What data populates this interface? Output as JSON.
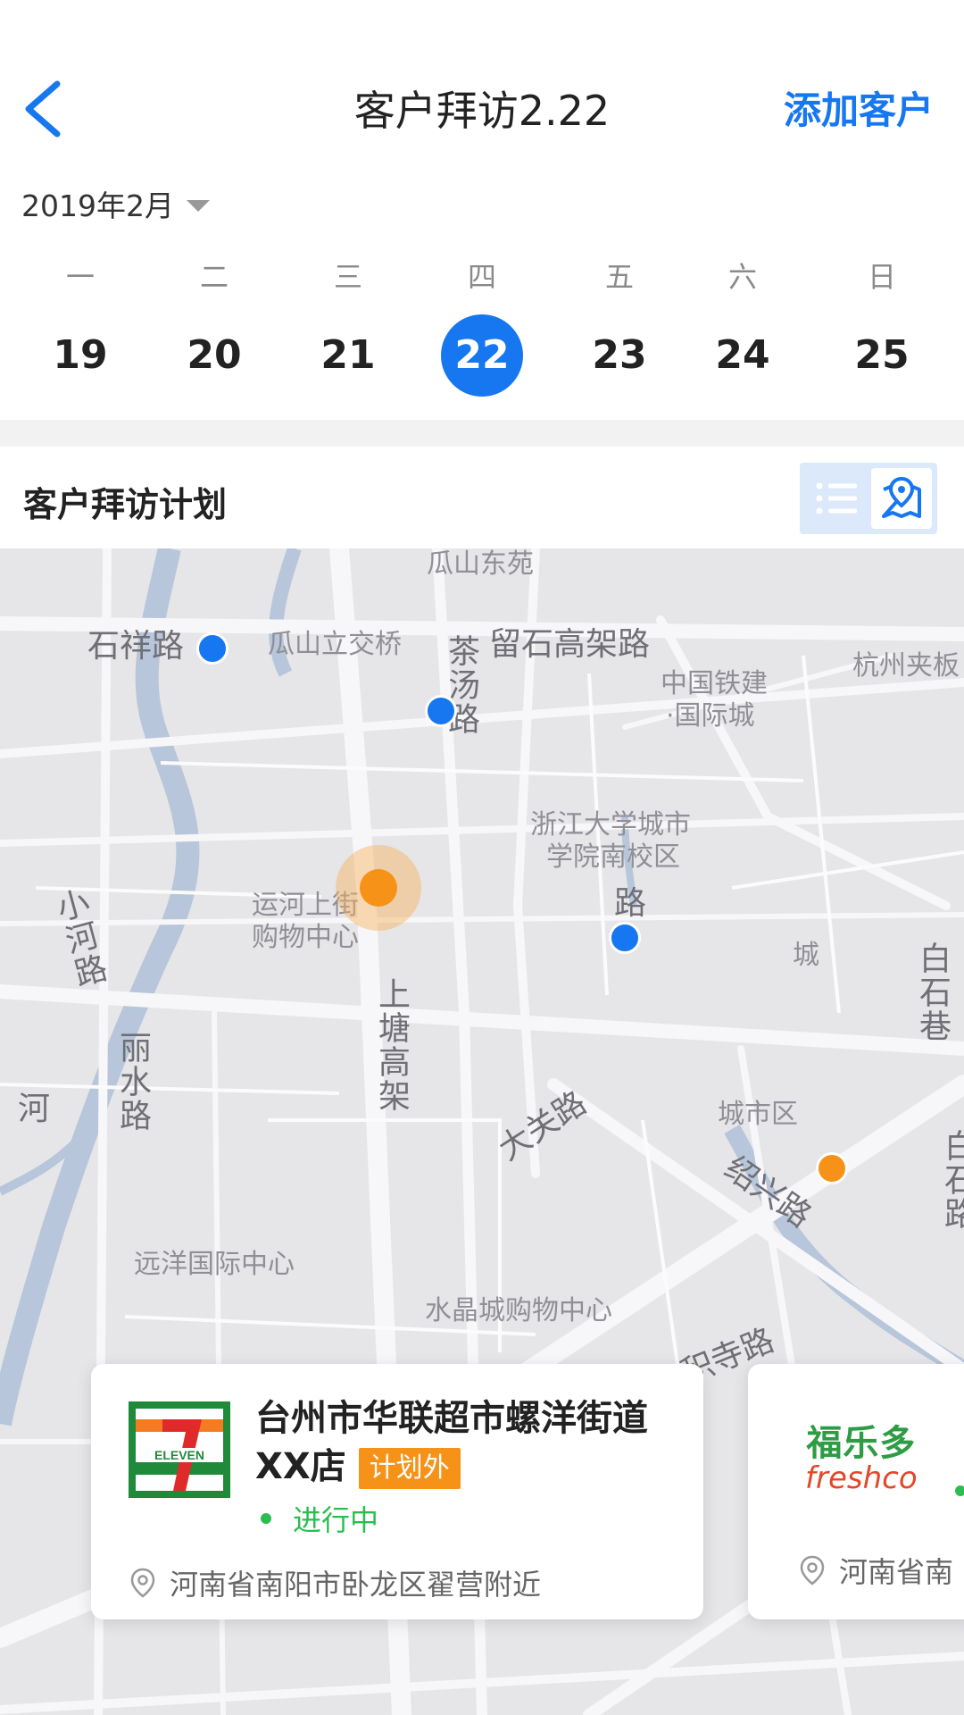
{
  "header": {
    "title": "客户拜访2.22",
    "add_label": "添加客户"
  },
  "calendar": {
    "month": "2019年2月",
    "days": [
      {
        "weekday": "一",
        "date": "19"
      },
      {
        "weekday": "二",
        "date": "20"
      },
      {
        "weekday": "三",
        "date": "21"
      },
      {
        "weekday": "四",
        "date": "22",
        "selected": true
      },
      {
        "weekday": "五",
        "date": "23"
      },
      {
        "weekday": "六",
        "date": "24"
      },
      {
        "weekday": "日",
        "date": "25"
      }
    ]
  },
  "plan": {
    "title": "客户拜访计划"
  },
  "map": {
    "labels": {
      "shixiang_road": "石祥路",
      "guashan_bridge": "瓜山立交桥",
      "guashan_east": "瓜山东苑",
      "chatang_road": "茶汤路",
      "liushi_elevated": "留石高架路",
      "crcc_city": "中国铁建",
      "crcc_city2": "·国际城",
      "hangzhou_jiabo": "杭州夹板",
      "zju_city_1": "浙江大学城市",
      "zju_city_2": "学院南校区",
      "road_small": "路",
      "yunhe_1": "运河上街",
      "yunhe_2": "购物中心",
      "xiaohe_road": "小河路",
      "shangtang": "上塘高架",
      "lishui_road": "丽水路",
      "river": "河",
      "daguan_road": "大关路",
      "city_district": "城市区",
      "shaoxing_road": "绍兴路",
      "baishi_lane": "白石巷",
      "baishi_road": "白石路",
      "cheng": "城",
      "yuanyang": "远洋国际中心",
      "shuijing": "水晶城购物中心",
      "jisi_road": "积寺路"
    },
    "pins": [
      {
        "color": "blue"
      },
      {
        "color": "blue"
      },
      {
        "color": "orange",
        "current": true
      },
      {
        "color": "blue"
      },
      {
        "color": "orange"
      }
    ]
  },
  "cards": [
    {
      "name": "台州市华联超市螺洋街道XX店",
      "tag": "计划外",
      "status": "进行中",
      "address": "河南省南阳市卧龙区翟营附近",
      "logo": "7-eleven-logo"
    },
    {
      "logo_cn": "福乐多",
      "logo_en": "freshco",
      "address": "河南省南"
    }
  ],
  "colors": {
    "accent": "#1677f0",
    "orange": "#f79218",
    "green": "#2bbd4f"
  }
}
